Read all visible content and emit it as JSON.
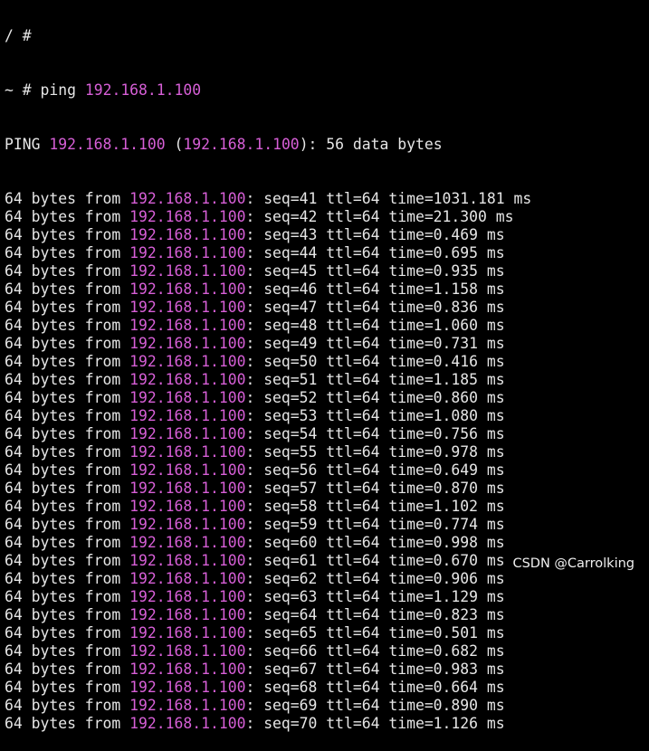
{
  "terminal": {
    "partial_top": "/ #",
    "prompt": "~ # ",
    "command": "ping",
    "target": "192.168.1.100",
    "header": {
      "prefix": "PING ",
      "host": "192.168.1.100",
      "open_paren": " (",
      "ip": "192.168.1.100",
      "suffix": "): 56 data bytes"
    },
    "reply_prefix": "64 bytes from ",
    "replies": [
      {
        "ip": "192.168.1.100",
        "rest": ": seq=41 ttl=64 time=1031.181 ms"
      },
      {
        "ip": "192.168.1.100",
        "rest": ": seq=42 ttl=64 time=21.300 ms"
      },
      {
        "ip": "192.168.1.100",
        "rest": ": seq=43 ttl=64 time=0.469 ms"
      },
      {
        "ip": "192.168.1.100",
        "rest": ": seq=44 ttl=64 time=0.695 ms"
      },
      {
        "ip": "192.168.1.100",
        "rest": ": seq=45 ttl=64 time=0.935 ms"
      },
      {
        "ip": "192.168.1.100",
        "rest": ": seq=46 ttl=64 time=1.158 ms"
      },
      {
        "ip": "192.168.1.100",
        "rest": ": seq=47 ttl=64 time=0.836 ms"
      },
      {
        "ip": "192.168.1.100",
        "rest": ": seq=48 ttl=64 time=1.060 ms"
      },
      {
        "ip": "192.168.1.100",
        "rest": ": seq=49 ttl=64 time=0.731 ms"
      },
      {
        "ip": "192.168.1.100",
        "rest": ": seq=50 ttl=64 time=0.416 ms"
      },
      {
        "ip": "192.168.1.100",
        "rest": ": seq=51 ttl=64 time=1.185 ms"
      },
      {
        "ip": "192.168.1.100",
        "rest": ": seq=52 ttl=64 time=0.860 ms"
      },
      {
        "ip": "192.168.1.100",
        "rest": ": seq=53 ttl=64 time=1.080 ms"
      },
      {
        "ip": "192.168.1.100",
        "rest": ": seq=54 ttl=64 time=0.756 ms"
      },
      {
        "ip": "192.168.1.100",
        "rest": ": seq=55 ttl=64 time=0.978 ms"
      },
      {
        "ip": "192.168.1.100",
        "rest": ": seq=56 ttl=64 time=0.649 ms"
      },
      {
        "ip": "192.168.1.100",
        "rest": ": seq=57 ttl=64 time=0.870 ms"
      },
      {
        "ip": "192.168.1.100",
        "rest": ": seq=58 ttl=64 time=1.102 ms"
      },
      {
        "ip": "192.168.1.100",
        "rest": ": seq=59 ttl=64 time=0.774 ms"
      },
      {
        "ip": "192.168.1.100",
        "rest": ": seq=60 ttl=64 time=0.998 ms"
      },
      {
        "ip": "192.168.1.100",
        "rest": ": seq=61 ttl=64 time=0.670 ms"
      },
      {
        "ip": "192.168.1.100",
        "rest": ": seq=62 ttl=64 time=0.906 ms"
      },
      {
        "ip": "192.168.1.100",
        "rest": ": seq=63 ttl=64 time=1.129 ms"
      },
      {
        "ip": "192.168.1.100",
        "rest": ": seq=64 ttl=64 time=0.823 ms"
      },
      {
        "ip": "192.168.1.100",
        "rest": ": seq=65 ttl=64 time=0.501 ms"
      },
      {
        "ip": "192.168.1.100",
        "rest": ": seq=66 ttl=64 time=0.682 ms"
      },
      {
        "ip": "192.168.1.100",
        "rest": ": seq=67 ttl=64 time=0.983 ms"
      },
      {
        "ip": "192.168.1.100",
        "rest": ": seq=68 ttl=64 time=0.664 ms"
      },
      {
        "ip": "192.168.1.100",
        "rest": ": seq=69 ttl=64 time=0.890 ms"
      },
      {
        "ip": "192.168.1.100",
        "rest": ": seq=70 ttl=64 time=1.126 ms"
      }
    ]
  },
  "watermark": "CSDN @Carrolking",
  "colors": {
    "background": "#000000",
    "text": "#e6e6e6",
    "ip_highlight": "#d75fd7"
  }
}
